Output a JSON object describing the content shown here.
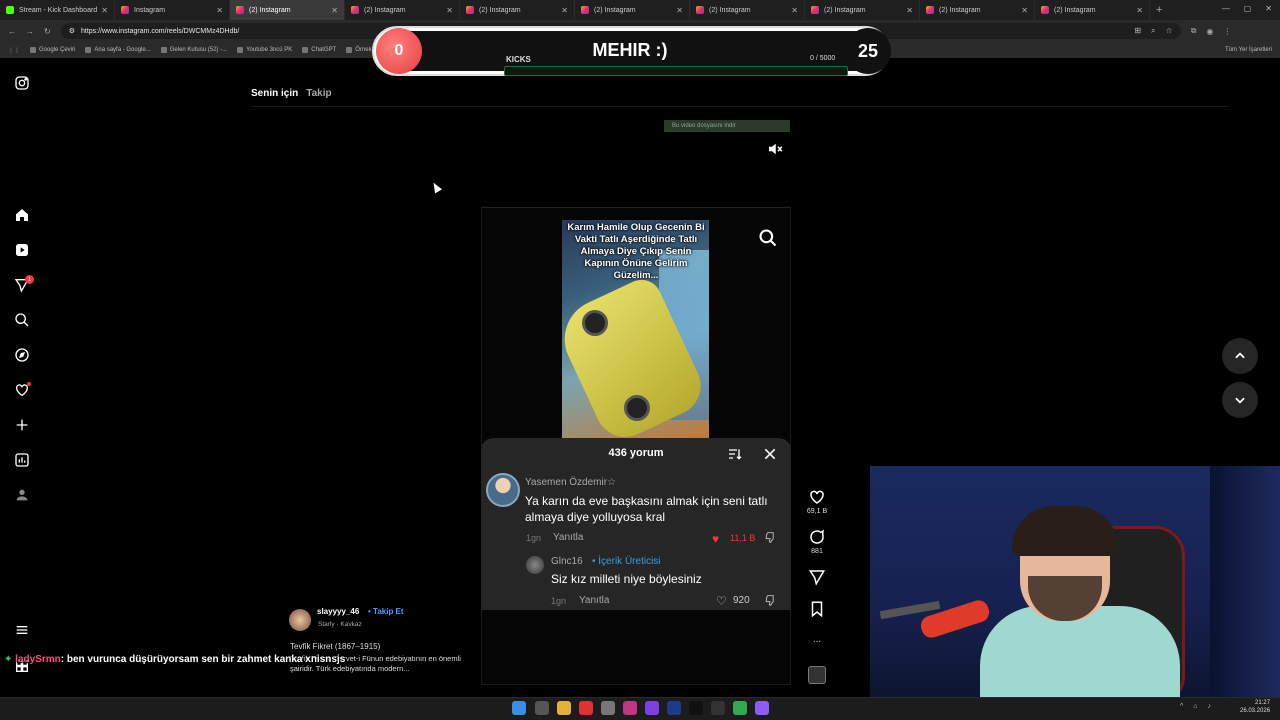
{
  "browser": {
    "tabs": [
      {
        "label": "Stream - Kick Dashboard",
        "icon": "kick-icon"
      },
      {
        "label": "Instagram",
        "icon": "instagram-icon"
      },
      {
        "label": "(2) Instagram",
        "icon": "instagram-icon"
      },
      {
        "label": "(2) Instagram",
        "icon": "instagram-icon"
      },
      {
        "label": "(2) Instagram",
        "icon": "instagram-icon"
      },
      {
        "label": "(2) Instagram",
        "icon": "instagram-icon"
      },
      {
        "label": "(2) Instagram",
        "icon": "instagram-icon"
      },
      {
        "label": "(2) Instagram",
        "icon": "instagram-icon"
      },
      {
        "label": "(2) Instagram",
        "icon": "instagram-icon"
      },
      {
        "label": "(2) Instagram",
        "icon": "instagram-icon"
      }
    ],
    "active_tab_index": 2,
    "url": "https://www.instagram.com/reels/DWCMMz4DHdb/",
    "bookmarks": [
      "Google Çeviri",
      "Ana sayfa - Google...",
      "Gelen Kutusu (52) -...",
      "Youtube 3ncü PK",
      "ChatGPT",
      "Örnek",
      "Transcript of \"MI M...",
      "türkçe h...",
      "You",
      "and reduce i...",
      "HeyGen - Projects",
      "BURÇ",
      "Esperan...",
      "The best ChatBot an...",
      "Flow"
    ],
    "all_bookmarks_label": "Tüm Yer İşaretleri"
  },
  "overlay": {
    "left_value": "0",
    "title": "MEHIR :)",
    "right_value": "25",
    "kicks_label": "KICKS",
    "kicks_count": "0 / 5000",
    "kicks_progress": 0
  },
  "feed": {
    "tab_for_you": "Senin için",
    "tab_following": "Takip"
  },
  "reel": {
    "preview_tag": "Bu video dosyasını indir",
    "caption": "Karım Hamile Olup Gecenin Bi Vakti Tatlı Aşerdiğinde Tatlı Almaya Diye Çıkıp Senin Kapının Önüne Gelirim Güzelim..."
  },
  "comments_panel": {
    "title": "436 yorum",
    "comments": [
      {
        "user": "Yasemen Özdemir☆",
        "text": "Ya karın da eve başkasını almak için seni tatlı almaya diye yolluyosa kral",
        "time": "1gn",
        "reply_label": "Yanıtla",
        "likes": "11,1 B"
      },
      {
        "user": "Glnc16",
        "creator_label": "• İçerik Üreticisi",
        "text": "Siz kız milleti niye böylesiniz",
        "time": "1gn",
        "reply_label": "Yanıtla",
        "likes": "920"
      }
    ]
  },
  "actions": {
    "likes": "69,1 B",
    "comments": "881",
    "more": "..."
  },
  "author": {
    "name": "slayyyy_46",
    "follow_label": "• Takip Et",
    "audio": "Starly · Kavkaz",
    "desc_line1": "Tevfik Fikret (1867–1915)",
    "desc_line2": "Tevfik Fikret, Servet-i Fünun edebiyatının en önemli şairidir. Türk edebiyatında modern..."
  },
  "chat": {
    "user": "ladySrmn",
    "message": ": ben vurunca düşürüyorsam sen bir zahmet kanka xnisnsjs"
  },
  "taskbar": {
    "time": "21:27",
    "date": "26.03.2026"
  },
  "colors": {
    "accent_red": "#ff3040",
    "ig_blue": "#4a9eff",
    "kick_green": "#53fc18",
    "creator_blue": "#3c9ed8"
  }
}
